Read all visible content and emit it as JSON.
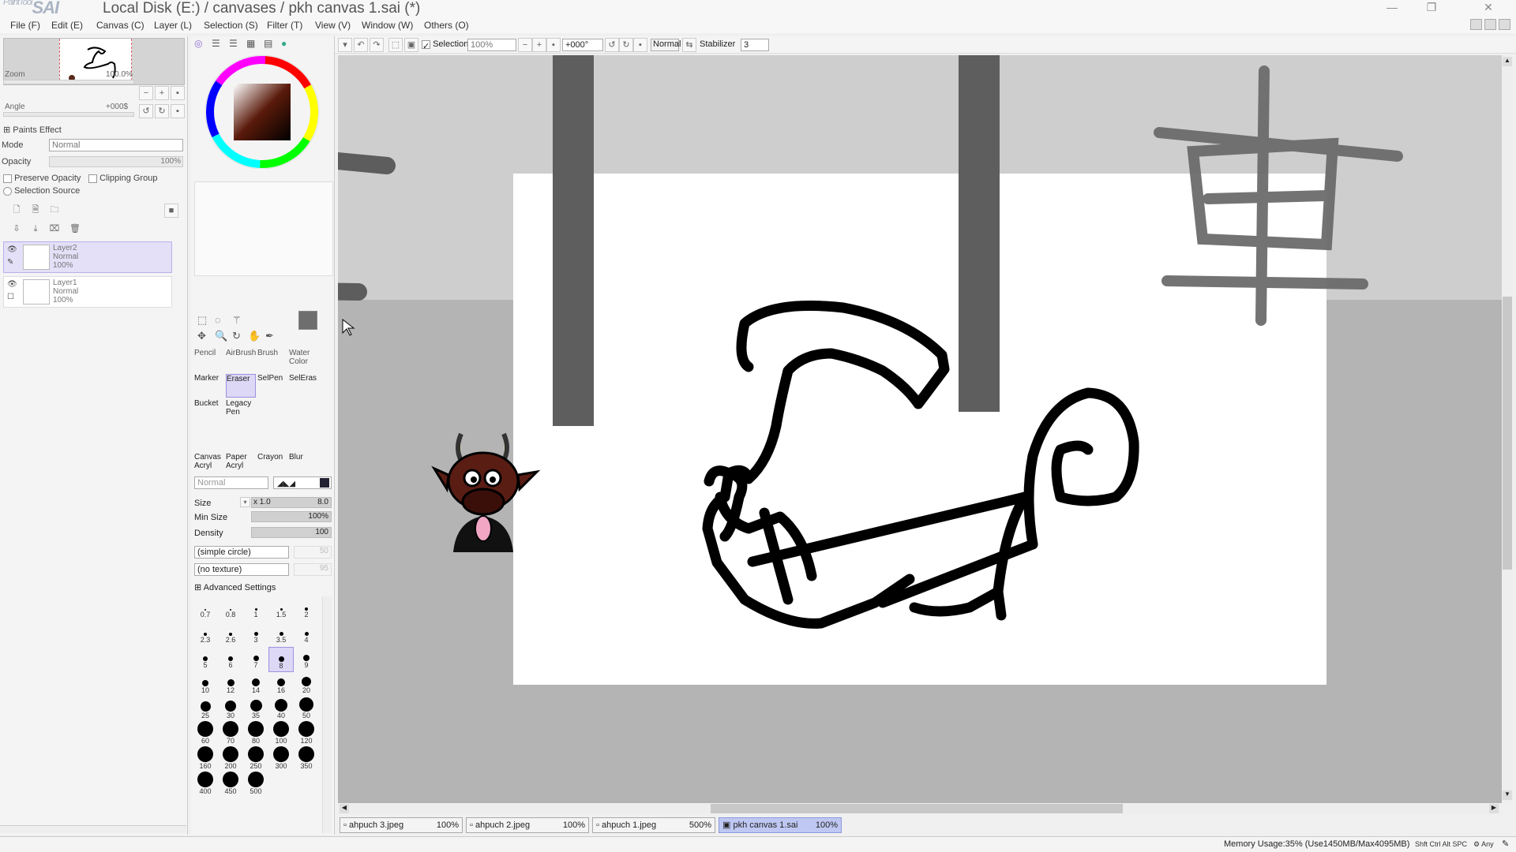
{
  "window": {
    "app_logo": "SAI",
    "app_logo_prefix": "PaintTool",
    "title": "Local Disk (E:) / canvases / pkh canvas 1.sai (*)",
    "minimize": "—",
    "restore": "❐",
    "close": "✕"
  },
  "menu": [
    {
      "label": "File (F)"
    },
    {
      "label": "Edit (E)"
    },
    {
      "label": "Canvas (C)"
    },
    {
      "label": "Layer (L)"
    },
    {
      "label": "Selection (S)"
    },
    {
      "label": "Filter (T)"
    },
    {
      "label": "View (V)"
    },
    {
      "label": "Window (W)"
    },
    {
      "label": "Others (O)"
    }
  ],
  "navigator": {
    "zoom_label": "Zoom",
    "zoom_value": "100.0%",
    "angle_label": "Angle",
    "angle_value": "+000$"
  },
  "layer_panel": {
    "paints_effect": "Paints Effect",
    "mode_label": "Mode",
    "mode_value": "Normal",
    "opacity_label": "Opacity",
    "opacity_value": "100%",
    "preserve_opacity": "Preserve Opacity",
    "clipping_group": "Clipping Group",
    "selection_source": "Selection Source",
    "layers": [
      {
        "name": "Layer2",
        "mode": "Normal",
        "opacity": "100%",
        "selected": true
      },
      {
        "name": "Layer1",
        "mode": "Normal",
        "opacity": "100%",
        "selected": false
      }
    ]
  },
  "tools": {
    "row1": [
      {
        "label": "Pencil"
      },
      {
        "label": "AirBrush"
      },
      {
        "label": "Brush"
      },
      {
        "label": "Water Color"
      }
    ],
    "row2": [
      {
        "label": "Marker"
      },
      {
        "label": "Eraser",
        "selected": true
      },
      {
        "label": "SelPen"
      },
      {
        "label": "SelEras"
      }
    ],
    "row3": [
      {
        "label": "Bucket"
      },
      {
        "label": "Legacy Pen"
      }
    ],
    "row4": [
      {
        "label": "Canvas Acryl"
      },
      {
        "label": "Paper Acryl"
      },
      {
        "label": "Crayon"
      },
      {
        "label": "Blur"
      }
    ],
    "blend_mode": "Normal",
    "size_label": "Size",
    "size_mult": "x 1.0",
    "size_value": "8.0",
    "min_size_label": "Min Size",
    "min_size_value": "100%",
    "density_label": "Density",
    "density_value": "100",
    "shape_dd": "(simple circle)",
    "shape_val": "50",
    "texture_dd": "(no texture)",
    "texture_val": "95",
    "advanced": "Advanced Settings",
    "brush_sizes": [
      "0.7",
      "0.8",
      "1",
      "1.5",
      "2",
      "2.3",
      "2.6",
      "3",
      "3.5",
      "4",
      "5",
      "6",
      "7",
      "8",
      "9",
      "10",
      "12",
      "14",
      "16",
      "20",
      "25",
      "30",
      "35",
      "40",
      "50",
      "60",
      "70",
      "80",
      "100",
      "120",
      "160",
      "200",
      "250",
      "300",
      "350",
      "400",
      "450",
      "500"
    ],
    "selected_brush_size": "8"
  },
  "canvas_toolbar": {
    "selection_label": "Selection",
    "zoom": "100%",
    "rotation": "+000°",
    "blend": "Normal",
    "stabilizer_label": "Stabilizer",
    "stabilizer_value": "3"
  },
  "doc_tabs": [
    {
      "name": "ahpuch 3.jpeg",
      "zoom": "100%",
      "active": false
    },
    {
      "name": "ahpuch 2.jpeg",
      "zoom": "100%",
      "active": false
    },
    {
      "name": "ahpuch 1.jpeg",
      "zoom": "500%",
      "active": false
    },
    {
      "name": "pkh canvas 1.sai",
      "zoom": "100%",
      "active": true
    }
  ],
  "status": {
    "memory": "Memory Usage:35% (Use1450MB/Max4095MB)",
    "keys": "Shft Ctrl Alt SPC",
    "any": "Any"
  }
}
